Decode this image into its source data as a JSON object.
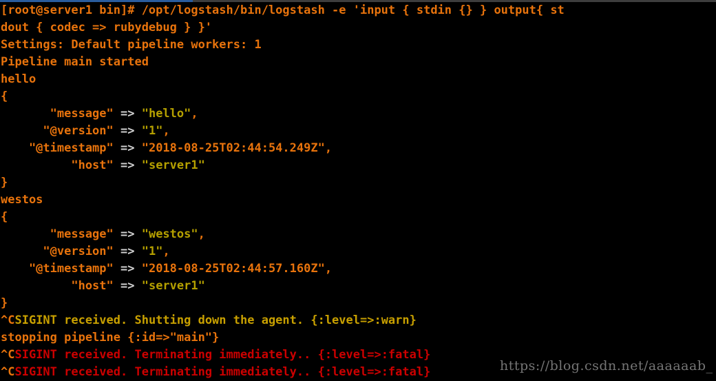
{
  "terminal": {
    "title": "root@server1:/opt/logstash/bin",
    "prompt": "[root@server1 bin]# ",
    "command": "/opt/logstash/bin/logstash -e 'input { stdin {} } output{ stdout { codec => rubydebug } }'",
    "background_color": "#000000",
    "colors": {
      "orange": "#e8730c",
      "olive": "#b5a000",
      "grey": "#d2d2d2",
      "yellow": "#c8a000",
      "red": "#cc0000",
      "scrollbar": "#2a5d9e"
    }
  },
  "lines": [
    {
      "id": "prompt-line-1",
      "type": "command",
      "segments": [
        {
          "text": "[root@server1 bin]# /opt/logstash/bin/logstash -e 'input { stdin {} } output{ st",
          "color": "orange"
        }
      ]
    },
    {
      "id": "prompt-line-2",
      "type": "command-wrap",
      "segments": [
        {
          "text": "dout { codec => rubydebug } }'",
          "color": "orange"
        }
      ]
    },
    {
      "id": "settings-line",
      "type": "output",
      "segments": [
        {
          "text": "Settings: Default pipeline workers: 1",
          "color": "orange"
        }
      ]
    },
    {
      "id": "pipeline-started-line",
      "type": "output",
      "segments": [
        {
          "text": "Pipeline main started",
          "color": "orange"
        }
      ]
    },
    {
      "id": "stdin-echo-hello",
      "type": "input-echo",
      "segments": [
        {
          "text": "hello",
          "color": "orange"
        }
      ]
    },
    {
      "id": "event1-open-brace",
      "type": "output",
      "segments": [
        {
          "text": "{",
          "color": "orange"
        }
      ]
    },
    {
      "id": "event1-message",
      "type": "field",
      "segments": [
        {
          "text": "       \"message\"",
          "color": "orange"
        },
        {
          "text": " => ",
          "color": "grey"
        },
        {
          "text": "\"hello\"",
          "color": "olive"
        },
        {
          "text": ",",
          "color": "orange"
        }
      ]
    },
    {
      "id": "event1-version",
      "type": "field",
      "segments": [
        {
          "text": "      \"@version\"",
          "color": "orange"
        },
        {
          "text": " => ",
          "color": "grey"
        },
        {
          "text": "\"1\"",
          "color": "olive"
        },
        {
          "text": ",",
          "color": "orange"
        }
      ]
    },
    {
      "id": "event1-timestamp",
      "type": "field",
      "segments": [
        {
          "text": "    \"@timestamp\"",
          "color": "orange"
        },
        {
          "text": " => ",
          "color": "grey"
        },
        {
          "text": "\"2018-08-25T02:44:54.249Z\",",
          "color": "orange"
        }
      ]
    },
    {
      "id": "event1-host",
      "type": "field",
      "segments": [
        {
          "text": "          \"host\"",
          "color": "orange"
        },
        {
          "text": " => ",
          "color": "grey"
        },
        {
          "text": "\"server1\"",
          "color": "olive"
        }
      ]
    },
    {
      "id": "event1-close-brace",
      "type": "output",
      "segments": [
        {
          "text": "}",
          "color": "orange"
        }
      ]
    },
    {
      "id": "stdin-echo-westos",
      "type": "input-echo",
      "segments": [
        {
          "text": "westos",
          "color": "orange"
        }
      ]
    },
    {
      "id": "event2-open-brace",
      "type": "output",
      "segments": [
        {
          "text": "{",
          "color": "orange"
        }
      ]
    },
    {
      "id": "event2-message",
      "type": "field",
      "segments": [
        {
          "text": "       \"message\"",
          "color": "orange"
        },
        {
          "text": " => ",
          "color": "grey"
        },
        {
          "text": "\"westos\"",
          "color": "olive"
        },
        {
          "text": ",",
          "color": "orange"
        }
      ]
    },
    {
      "id": "event2-version",
      "type": "field",
      "segments": [
        {
          "text": "      \"@version\"",
          "color": "orange"
        },
        {
          "text": " => ",
          "color": "grey"
        },
        {
          "text": "\"1\"",
          "color": "olive"
        },
        {
          "text": ",",
          "color": "orange"
        }
      ]
    },
    {
      "id": "event2-timestamp",
      "type": "field",
      "segments": [
        {
          "text": "    \"@timestamp\"",
          "color": "orange"
        },
        {
          "text": " => ",
          "color": "grey"
        },
        {
          "text": "\"2018-08-25T02:44:57.160Z\",",
          "color": "orange"
        }
      ]
    },
    {
      "id": "event2-host",
      "type": "field",
      "segments": [
        {
          "text": "          \"host\"",
          "color": "orange"
        },
        {
          "text": " => ",
          "color": "grey"
        },
        {
          "text": "\"server1\"",
          "color": "olive"
        }
      ]
    },
    {
      "id": "event2-close-brace",
      "type": "output",
      "segments": [
        {
          "text": "}",
          "color": "orange"
        }
      ]
    },
    {
      "id": "sigint-warn-line",
      "type": "log-warn",
      "segments": [
        {
          "text": "^C",
          "color": "orange"
        },
        {
          "text": "SIGINT received. Shutting down the agent. {:level=>:warn}",
          "color": "yellow"
        }
      ]
    },
    {
      "id": "stopping-pipeline-line",
      "type": "output",
      "segments": [
        {
          "text": "stopping pipeline {:id=>\"main\"}",
          "color": "orange"
        }
      ]
    },
    {
      "id": "sigint-fatal-line-1",
      "type": "log-fatal",
      "segments": [
        {
          "text": "^C",
          "color": "orange"
        },
        {
          "text": "SIGINT received. Terminating immediately.. {:level=>:fatal}",
          "color": "red"
        }
      ]
    },
    {
      "id": "sigint-fatal-line-2",
      "type": "log-fatal",
      "segments": [
        {
          "text": "^C",
          "color": "orange"
        },
        {
          "text": "SIGINT received. Terminating immediately.. {:level=>:fatal}",
          "color": "red"
        }
      ]
    }
  ],
  "watermark": {
    "text": "https://blog.csdn.net/aaaaaab_"
  }
}
